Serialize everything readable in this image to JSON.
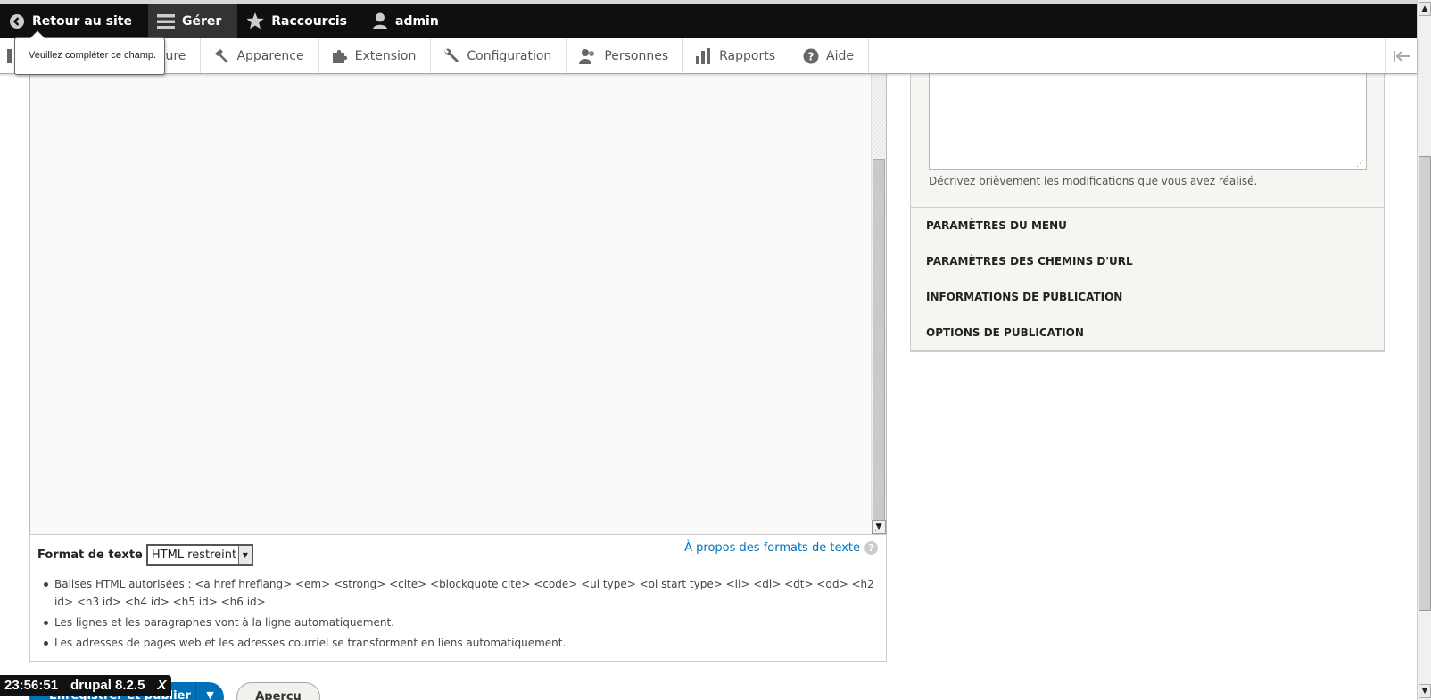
{
  "toolbar": {
    "back_label": "Retour au site",
    "manage_label": "Gérer",
    "shortcuts_label": "Raccourcis",
    "user_label": "admin"
  },
  "tray": {
    "items": [
      {
        "label": "ture",
        "icon": "structure-icon"
      },
      {
        "label": "Apparence",
        "icon": "paintbrush-icon"
      },
      {
        "label": "Extension",
        "icon": "puzzle-icon"
      },
      {
        "label": "Configuration",
        "icon": "wrench-icon"
      },
      {
        "label": "Personnes",
        "icon": "people-icon"
      },
      {
        "label": "Rapports",
        "icon": "bar-chart-icon"
      },
      {
        "label": "Aide",
        "icon": "help-icon"
      }
    ]
  },
  "tooltip": {
    "text": "Veuillez compléter ce champ."
  },
  "format": {
    "label": "Format de texte",
    "selected": "HTML restreint",
    "about_link": "À propos des formats de texte",
    "tips": [
      "Balises HTML autorisées : <a href hreflang> <em> <strong> <cite> <blockquote cite> <code> <ul type> <ol start type> <li> <dl> <dt> <dd> <h2 id> <h3 id> <h4 id> <h5 id> <h6 id>",
      "Les lignes et les paragraphes vont à la ligne automatiquement.",
      "Les adresses de pages web et les adresses courriel se transforment en liens automatiquement."
    ]
  },
  "sidebar": {
    "revision_description": "Décrivez brièvement les modifications que vous avez réalisé.",
    "sections": [
      "PARAMÈTRES DU MENU",
      "PARAMÈTRES DES CHEMINS D'URL",
      "INFORMATIONS DE PUBLICATION",
      "OPTIONS DE PUBLICATION"
    ]
  },
  "actions": {
    "save_label": "Enregistrer et publier",
    "preview_label": "Aperçu"
  },
  "overlay": {
    "time": "23:56:51",
    "version": "drupal 8.2.5",
    "close": "X"
  },
  "colors": {
    "toolbar_bg": "#0f0f0f",
    "link": "#0074bd",
    "primary_button": "#0071b8"
  }
}
